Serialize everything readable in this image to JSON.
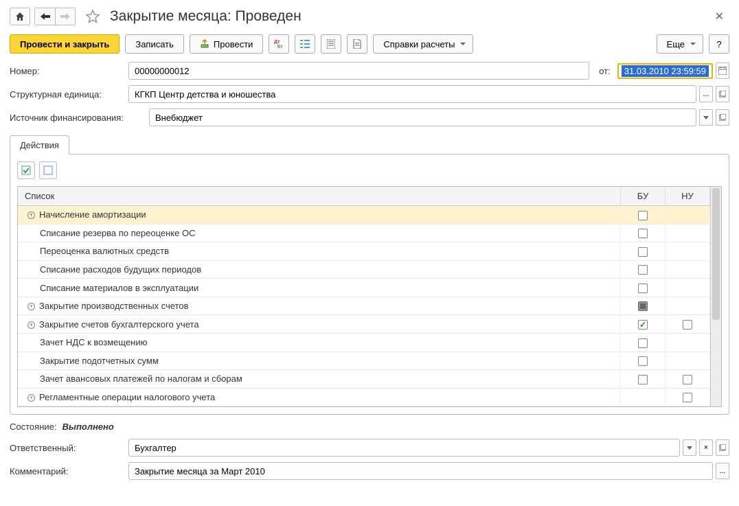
{
  "title": "Закрытие месяца: Проведен",
  "toolbar": {
    "main_button": "Провести и закрыть",
    "write": "Записать",
    "post": "Провести",
    "calc_ref": "Справки расчеты",
    "more": "Еще",
    "help": "?"
  },
  "form": {
    "number_label": "Номер:",
    "number_value": "00000000012",
    "date_label": "от:",
    "date_value": "31.03.2010 23:59:59",
    "org_label": "Структурная единица:",
    "org_value": "КГКП Центр детства и юношества",
    "fin_label": "Источник финансирования:",
    "fin_value": "Внебюджет"
  },
  "tab": "Действия",
  "table": {
    "col_list": "Список",
    "col_bu": "БУ",
    "col_nu": "НУ",
    "rows": [
      {
        "label": "Начисление амортизации",
        "expand": true,
        "bu": "empty",
        "nu": "none",
        "selected": true
      },
      {
        "label": "Списание резерва по переоценке ОС",
        "expand": false,
        "bu": "empty",
        "nu": "none"
      },
      {
        "label": "Переоценка валютных средств",
        "expand": false,
        "bu": "empty",
        "nu": "none"
      },
      {
        "label": "Списание расходов будущих периодов",
        "expand": false,
        "bu": "empty",
        "nu": "none"
      },
      {
        "label": "Списание материалов в эксплуатации",
        "expand": false,
        "bu": "empty",
        "nu": "none"
      },
      {
        "label": "Закрытие производственных счетов",
        "expand": true,
        "bu": "mixed",
        "nu": "none"
      },
      {
        "label": "Закрытие счетов бухгалтерского учета",
        "expand": true,
        "bu": "checked",
        "nu": "empty"
      },
      {
        "label": "Зачет НДС к возмещению",
        "expand": false,
        "bu": "empty",
        "nu": "none"
      },
      {
        "label": "Закрытие подотчетных сумм",
        "expand": false,
        "bu": "empty",
        "nu": "none"
      },
      {
        "label": "Зачет авансовых платежей по налогам и сборам",
        "expand": false,
        "bu": "empty",
        "nu": "empty"
      },
      {
        "label": "Регламентные операции налогового учета",
        "expand": true,
        "bu": "none",
        "nu": "empty"
      }
    ]
  },
  "status": {
    "label": "Состояние:",
    "value": "Выполнено"
  },
  "resp": {
    "label": "Ответственный:",
    "value": "Бухгалтер"
  },
  "comment": {
    "label": "Комментарий:",
    "value": "Закрытие месяца за Март 2010"
  }
}
